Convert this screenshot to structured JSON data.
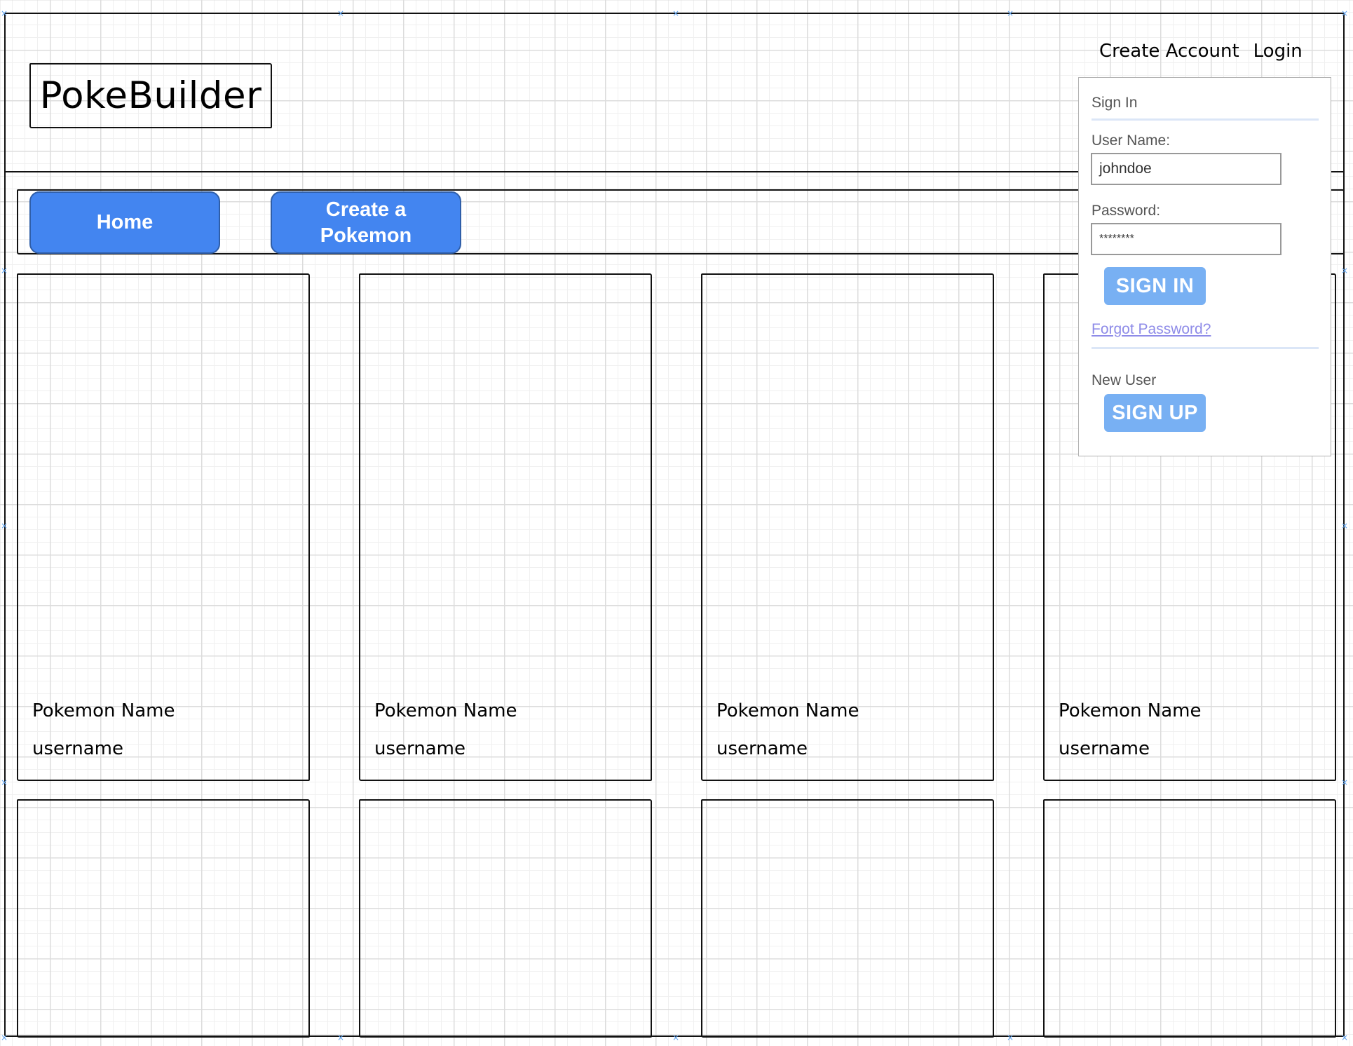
{
  "header": {
    "logo": "PokeBuilder",
    "links": [
      "Create Account",
      "Login"
    ]
  },
  "nav": {
    "home": "Home",
    "create_line1": "Create a",
    "create_line2": "Pokemon"
  },
  "cards": [
    {
      "name": "Pokemon Name",
      "user": "username"
    },
    {
      "name": "Pokemon Name",
      "user": "username"
    },
    {
      "name": "Pokemon Name",
      "user": "username"
    },
    {
      "name": "Pokemon Name",
      "user": "username"
    }
  ],
  "signin": {
    "title": "Sign In",
    "username_label": "User Name:",
    "username_value": "johndoe",
    "password_label": "Password:",
    "password_value": "********",
    "signin_button": "SIGN IN",
    "forgot": "Forgot Password?",
    "new_user": "New User",
    "signup_button": "SIGN UP"
  },
  "colors": {
    "nav_button": "#4385f0",
    "panel_button": "#78b0f3",
    "link": "#8e8be8"
  }
}
